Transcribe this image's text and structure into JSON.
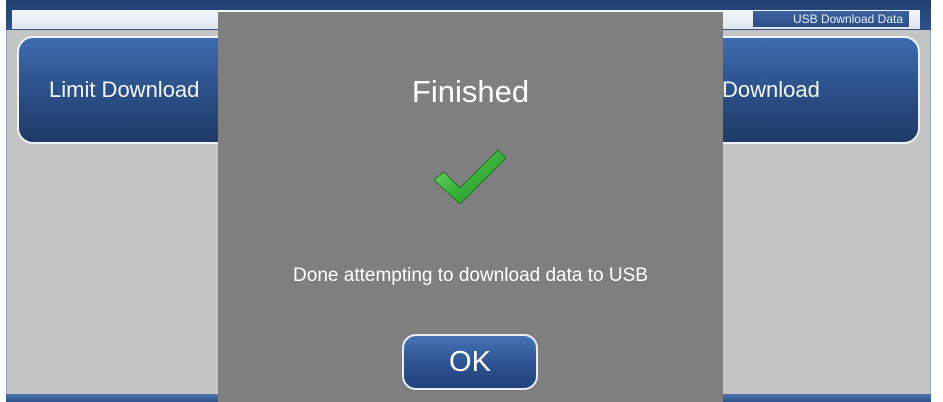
{
  "header": {
    "title": "USB Download Data"
  },
  "buttons": {
    "left_label": "Limit Download",
    "right_label": "Download"
  },
  "dialog": {
    "title": "Finished",
    "message": "Done attempting to download data to USB",
    "ok_label": "OK",
    "icon": "checkmark-icon",
    "icon_color": "#3cb43c"
  }
}
